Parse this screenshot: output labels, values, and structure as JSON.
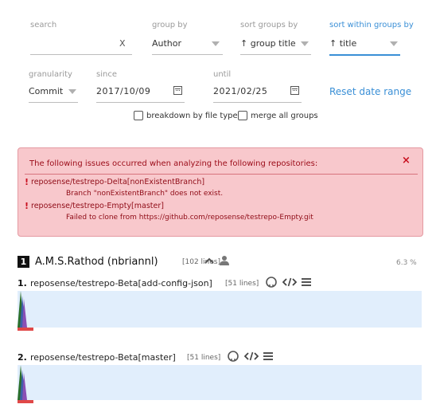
{
  "filters": {
    "search_label": "search",
    "search_clear": "X",
    "group_by_label": "group by",
    "group_by_value": "Author",
    "sort_groups_label": "sort groups by",
    "sort_groups_value": "↑ group title",
    "sort_within_label": "sort within groups by",
    "sort_within_value": "↑ title",
    "granularity_label": "granularity",
    "granularity_value": "Commit",
    "since_label": "since",
    "since_value": "2017/10/09",
    "until_label": "until",
    "until_value": "2021/02/25",
    "reset_label": "Reset date range",
    "breakdown_label": "breakdown by file type",
    "merge_label": "merge all groups"
  },
  "error_box": {
    "heading": "The following issues occurred when analyzing the following repositories:",
    "close": "×",
    "issues": [
      {
        "bang": "!",
        "repo": "reposense/testrepo-Delta[nonExistentBranch]",
        "message": "Branch \"nonExistentBranch\" does not exist."
      },
      {
        "bang": "!",
        "repo": "reposense/testrepo-Empty[master]",
        "message": "Failed to clone from https://github.com/reposense/testrepo-Empty.git"
      }
    ]
  },
  "author_group": {
    "rank": "1",
    "name": "A.M.S.Rathod (nbriannl)",
    "lines": "[102 lines]",
    "percent": "6.3 %",
    "repos": [
      {
        "num": "1.",
        "name": "reposense/testrepo-Beta[add-config-json]",
        "lines": "[51 lines]"
      },
      {
        "num": "2.",
        "name": "reposense/testrepo-Beta[master]",
        "lines": "[51 lines]"
      }
    ]
  },
  "colors": {
    "accent": "#3a8fd6",
    "error_bg": "#f8c8cc",
    "error_text": "#9b0b18",
    "ramp_bg": "#e1eefc",
    "bar_red": "#e04848"
  }
}
